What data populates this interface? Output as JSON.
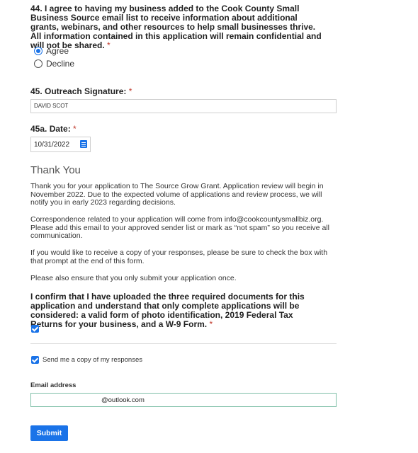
{
  "q44": {
    "text": "44. I agree to having my business added to the Cook County Small Business Source email list to receive information about additional grants, webinars, and other resources to help small businesses thrive. All information contained in this application will remain confidential and will not be shared.",
    "required_mark": "*",
    "options": [
      {
        "label": "Agree",
        "selected": true
      },
      {
        "label": "Decline",
        "selected": false
      }
    ]
  },
  "q45": {
    "label": "45. Outreach Signature:",
    "required_mark": "*",
    "value": "DAVID SCOT"
  },
  "q45a": {
    "label": "45a. Date:",
    "required_mark": "*",
    "value": "10/31/2022"
  },
  "thank_you": {
    "heading": "Thank You",
    "p1": "Thank you for your application to The Source Grow Grant. Application review will begin in November 2022. Due to the expected volume of applications and review process, we will notify you in early 2023 regarding decisions.",
    "p2": "Correspondence related to your application will come from info@cookcountysmallbiz.org. Please add this email to your approved sender list or mark as “not spam” so you receive all communication.",
    "p3": "If you would like to receive a copy of your responses, please be sure to check the box with that prompt at the end of this form.",
    "p4": "Please also ensure that you only submit your application once."
  },
  "confirm": {
    "text": "I confirm that I have uploaded the three required documents for this application and understand that only complete applications will be considered: a valid form of photo identification, 2019 Federal Tax Returns for your business, and a W-9 Form.",
    "required_mark": "*",
    "checked": true
  },
  "copy": {
    "label": "Send me a copy of my responses",
    "checked": true
  },
  "email": {
    "label": "Email address",
    "value": "@outlook.com"
  },
  "submit": {
    "label": "Submit"
  },
  "colors": {
    "accent": "#1a73e8",
    "required": "#c0392b"
  }
}
